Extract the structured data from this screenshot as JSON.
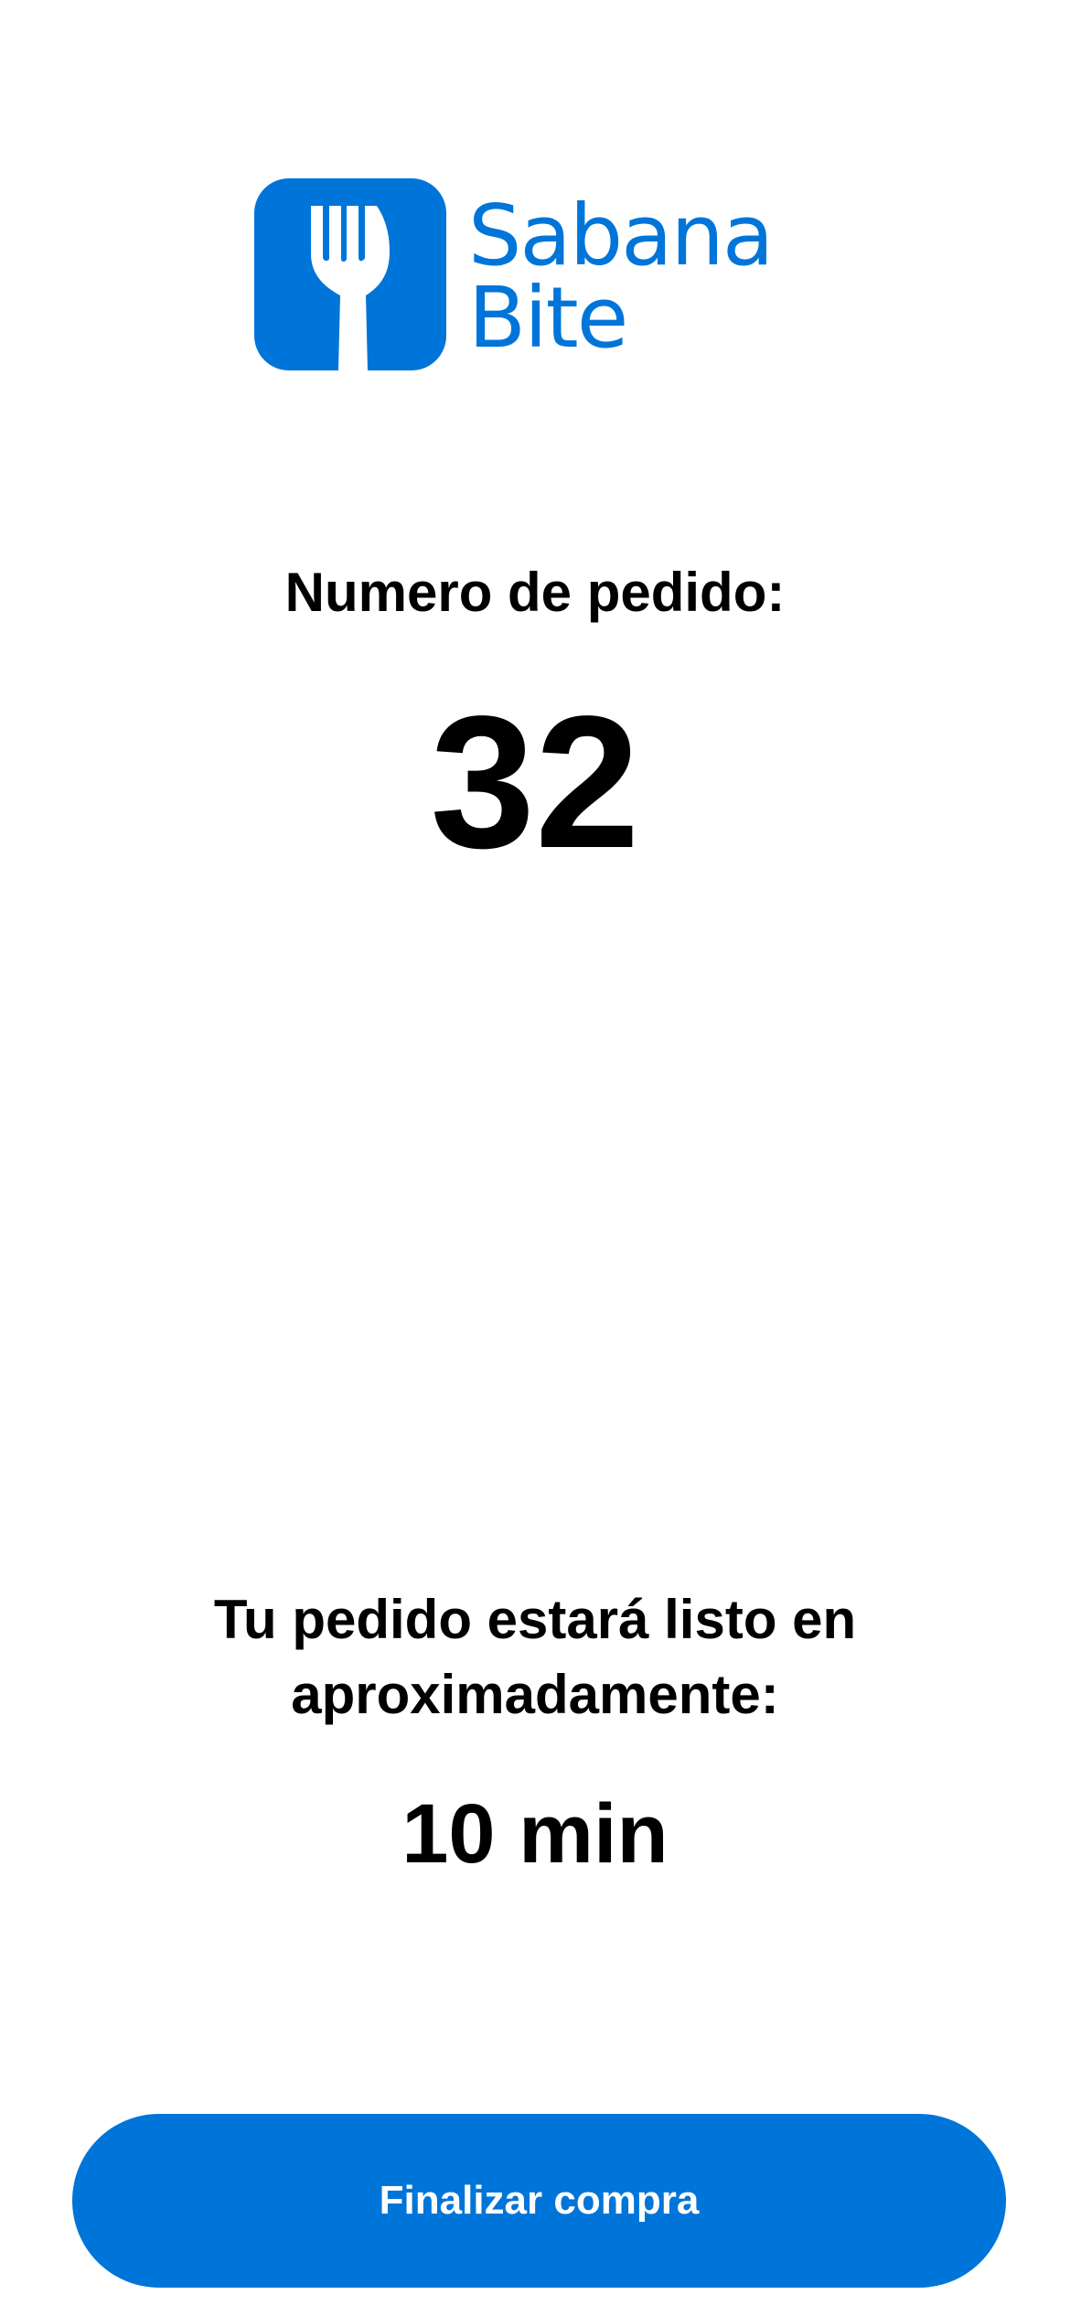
{
  "brand": {
    "line1": "Sabana",
    "line2": "Bite",
    "color": "#0075D9",
    "icon": "fork-icon"
  },
  "order": {
    "label": "Numero de pedido:",
    "number": "32"
  },
  "ready": {
    "line1": "Tu pedido estará listo en",
    "line2": "aproximadamente:",
    "time": "10 min"
  },
  "actions": {
    "finish_label": "Finalizar compra"
  }
}
